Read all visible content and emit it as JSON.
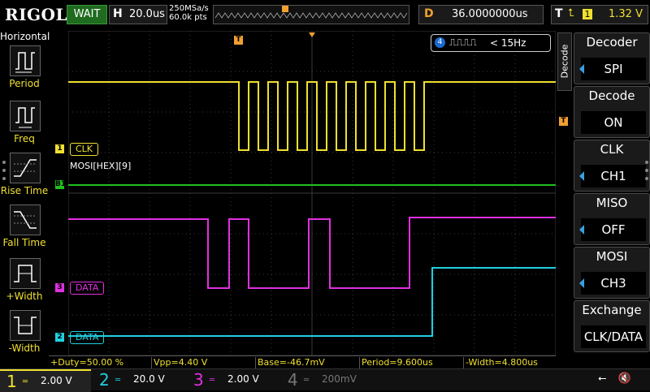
{
  "top": {
    "brand": "RIGOL",
    "status": "WAIT",
    "horizontal_label": "H",
    "timebase": "20.0us",
    "sample_rate": "250MSa/s",
    "memory_depth": "60.0k pts",
    "delay_label": "D",
    "delay_value": "36.0000000us",
    "trigger_label": "T",
    "trigger_channel": "1",
    "trigger_level": "1.32 V"
  },
  "left_menu": {
    "title": "Horizontal",
    "items": [
      {
        "label": "Period",
        "icon": "period-icon"
      },
      {
        "label": "Freq",
        "icon": "frequency-icon"
      },
      {
        "label": "Rise Time",
        "icon": "rise-time-icon"
      },
      {
        "label": "Fall Time",
        "icon": "fall-time-icon"
      },
      {
        "label": "+Width",
        "icon": "positive-width-icon"
      },
      {
        "label": "-Width",
        "icon": "negative-width-icon"
      }
    ]
  },
  "right_menu": {
    "side_tab": "Decode",
    "buttons": [
      {
        "title": "Decoder",
        "value": "SPI"
      },
      {
        "title": "Decode",
        "value": "ON"
      },
      {
        "title": "CLK",
        "value": "CH1"
      },
      {
        "title": "MISO",
        "value": "OFF"
      },
      {
        "title": "MOSI",
        "value": "CH3"
      },
      {
        "title": "Exchange",
        "value": "CLK/DATA"
      }
    ]
  },
  "screen": {
    "freq_counter_channel": "4",
    "freq_counter_value": "< 15Hz",
    "ch1_tag": "CLK",
    "ch3_tag": "DATA",
    "ch2_tag": "DATA",
    "bus_label": "MOSI[HEX][9]",
    "bus_marker": "B1",
    "trigger_marker": "T"
  },
  "measurements": [
    {
      "label": "+Duty=50.00 %"
    },
    {
      "label": "Vpp=4.40 V"
    },
    {
      "label": "Base=-46.7mV"
    },
    {
      "label": "Period=9.600us"
    },
    {
      "label": "-Width=4.800us"
    }
  ],
  "channels": [
    {
      "num": "1",
      "scale": "2.00 V",
      "color": "#f0e030"
    },
    {
      "num": "2",
      "scale": "20.0 V",
      "color": "#20d0e0"
    },
    {
      "num": "3",
      "scale": "2.00 V",
      "color": "#e030e0"
    },
    {
      "num": "4",
      "scale": "200mV",
      "color": "#3a6ad0"
    }
  ],
  "colors": {
    "ch1": "#f0e030",
    "ch2": "#20d0e0",
    "ch3": "#e030e0",
    "bus": "#20c020",
    "grid": "#3a3a3a",
    "trigger": "#f0a030"
  }
}
